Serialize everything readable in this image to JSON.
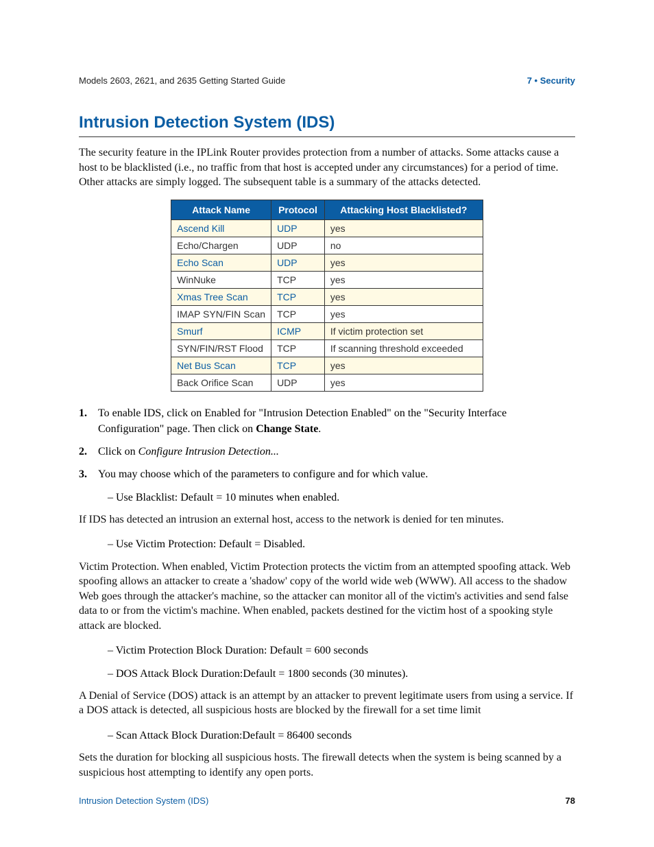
{
  "header": {
    "left": "Models 2603, 2621, and 2635 Getting Started Guide",
    "right": "7 • Security"
  },
  "section": {
    "title": "Intrusion Detection System (IDS)",
    "intro": "The security feature in the IPLink Router provides protection from a number of attacks. Some attacks cause a host to be blacklisted (i.e., no traffic from that host is accepted under any circumstances) for a period of time. Other attacks are simply logged. The subsequent table is a summary of the attacks detected."
  },
  "table": {
    "headers": [
      "Attack Name",
      "Protocol",
      "Attacking Host Blacklisted?"
    ],
    "rows": [
      {
        "name": "Ascend Kill",
        "proto": "UDP",
        "bl": "yes",
        "cls": "odd"
      },
      {
        "name": "Echo/Chargen",
        "proto": "UDP",
        "bl": "no",
        "cls": "even"
      },
      {
        "name": "Echo Scan",
        "proto": "UDP",
        "bl": "yes",
        "cls": "odd"
      },
      {
        "name": "WinNuke",
        "proto": "TCP",
        "bl": "yes",
        "cls": "even"
      },
      {
        "name": "Xmas Tree Scan",
        "proto": "TCP",
        "bl": "yes",
        "cls": "odd"
      },
      {
        "name": "IMAP SYN/FIN Scan",
        "proto": "TCP",
        "bl": "yes",
        "cls": "even"
      },
      {
        "name": "Smurf",
        "proto": "ICMP",
        "bl": "If victim protection set",
        "cls": "odd"
      },
      {
        "name": "SYN/FIN/RST Flood",
        "proto": "TCP",
        "bl": "If scanning threshold exceeded",
        "cls": "even"
      },
      {
        "name": "Net Bus Scan",
        "proto": "TCP",
        "bl": "yes",
        "cls": "odd"
      },
      {
        "name": "Back Orifice Scan",
        "proto": "UDP",
        "bl": "yes",
        "cls": "even"
      }
    ]
  },
  "steps": {
    "s1a": "To enable IDS, click on Enabled for \"Intrusion Detection Enabled\" on the \"Security Interface Configuration\" page. Then click on ",
    "s1b": "Change State",
    "s1c": ".",
    "s2a": "Click on ",
    "s2b": "Configure Intrusion Detection...",
    "s3": "You may choose which of the parameters to configure and for which value.",
    "n1": "1.",
    "n2": "2.",
    "n3": "3."
  },
  "bullets": {
    "b1": "– Use Blacklist: Default = 10 minutes when enabled.",
    "b2": "– Use Victim Protection: Default = Disabled.",
    "b3": "– Victim Protection Block Duration: Default = 600 seconds",
    "b4": "– DOS Attack Block Duration:Default = 1800 seconds (30 minutes).",
    "b5": "– Scan Attack Block Duration:Default = 86400 seconds"
  },
  "paras": {
    "p1": "If IDS has detected an intrusion an external host, access to the network is denied for ten minutes.",
    "p2": "Victim Protection. When enabled, Victim Protection protects the victim from an attempted spoofing attack. Web spoofing allows an attacker to create a 'shadow' copy of the world wide web (WWW). All access to the shadow Web goes through the attacker's machine, so the attacker can monitor all of the victim's activities and send false data to or from the victim's machine. When enabled, packets destined for the victim host of a spooking style attack are blocked.",
    "p3": "A Denial of Service (DOS) attack is an attempt by an attacker to prevent legitimate users from using a service. If a DOS attack is detected, all suspicious hosts are blocked by the firewall for a set time limit",
    "p4": "Sets the duration for blocking all suspicious hosts. The firewall detects when the system is being scanned by a suspicious host attempting to identify any open ports."
  },
  "footer": {
    "left": "Intrusion Detection System (IDS)",
    "right": "78"
  }
}
